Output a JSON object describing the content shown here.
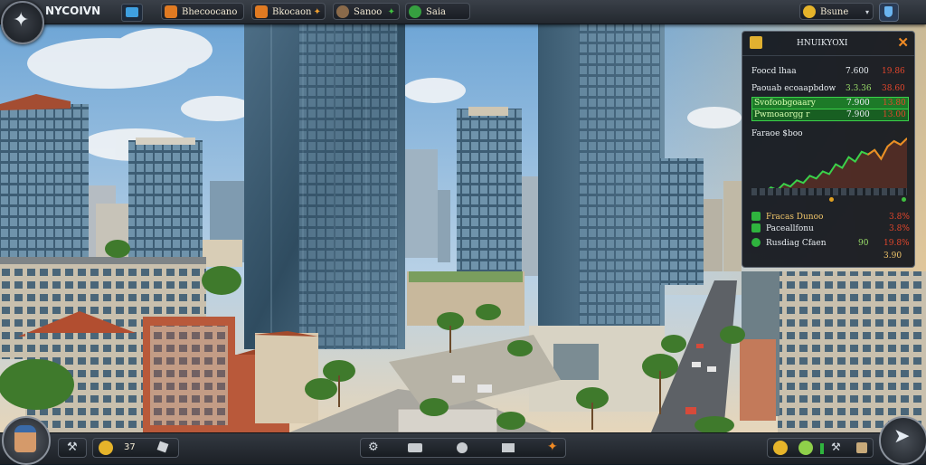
{
  "hud": {
    "brand": "NYCOIVN",
    "resource_1": "Bhecoocano",
    "resource_2": "Bkocaon",
    "resource_3": "Sanoo",
    "resource_4": "Saia",
    "player_name": "Bsune"
  },
  "market_panel": {
    "title": "HNUIKYOXI",
    "rows": [
      {
        "label": "Foocd lhaa",
        "v1": "7.600",
        "v2": "19.86"
      },
      {
        "label": "Paouab ecoaapbdow",
        "v1": "3.3.36",
        "v2": "38.60"
      },
      {
        "label": "Svofoobgoaary",
        "v1": "7.900",
        "v2": "13.80"
      },
      {
        "label": "Pwmoaorgg r",
        "v1": "7.900",
        "v2": "13.00"
      }
    ],
    "graph_title": "Faraoe $boo",
    "tasks": [
      {
        "label": "Fracas Dunoo",
        "value": "",
        "delta": "3.8%"
      },
      {
        "label": "Paceallfonu",
        "value": "",
        "delta": "3.8%"
      },
      {
        "label": "Rusdiag Cfaen",
        "value": "90",
        "delta": "19.8%"
      }
    ],
    "total": "3.90"
  },
  "bottom": {
    "coins": "37"
  },
  "colors": {
    "accent_green": "#3bd24a",
    "accent_orange": "#f08a24",
    "gain_red": "#e4462c",
    "hud_dark": "#1c2026"
  },
  "chart_data": {
    "type": "line",
    "title": "Faraoe $boo",
    "values": [
      10,
      14,
      12,
      18,
      15,
      22,
      19,
      26,
      23,
      31,
      28,
      36,
      33,
      44,
      40,
      52,
      47,
      58,
      55,
      60,
      50,
      64,
      70,
      66,
      73
    ]
  }
}
